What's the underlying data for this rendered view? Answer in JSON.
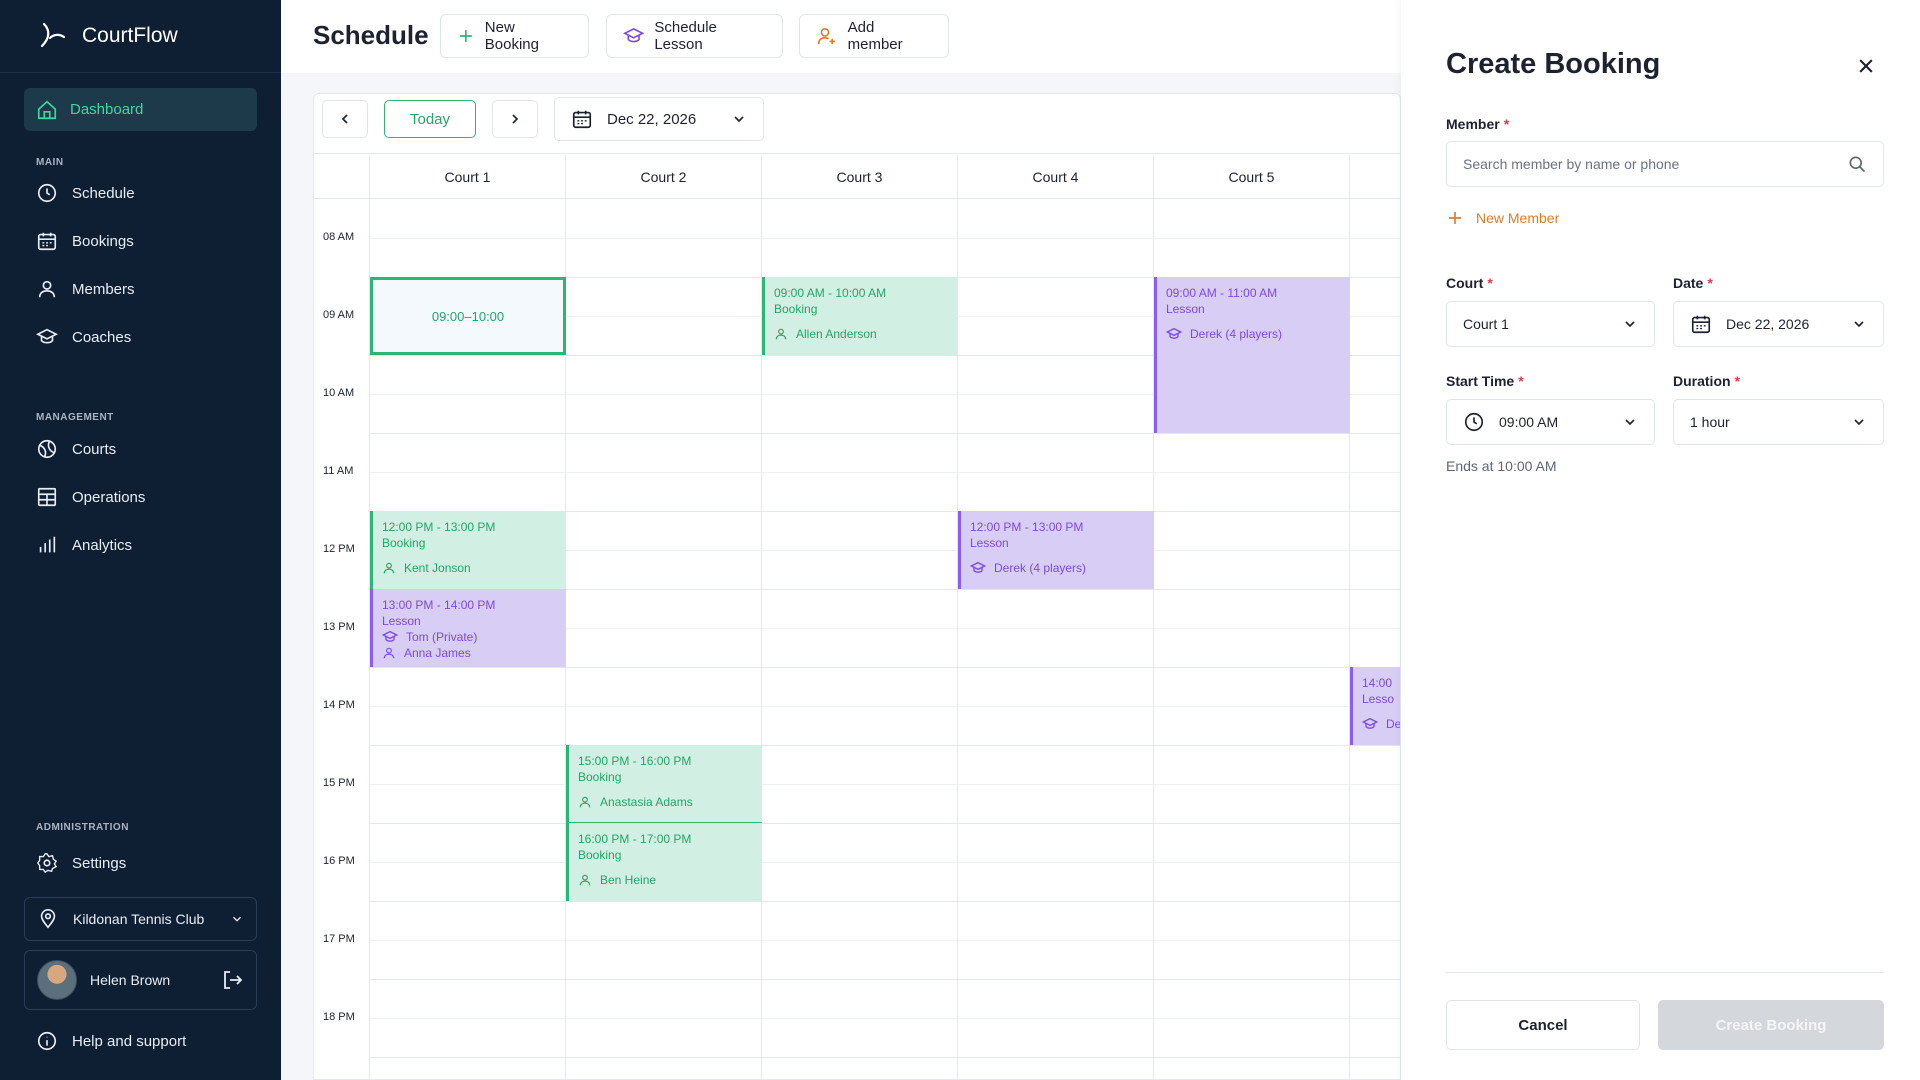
{
  "app": {
    "name": "CourtFlow"
  },
  "sidebar": {
    "dashboard_label": "Dashboard",
    "sections": {
      "main": "MAIN",
      "management": "MANAGEMENT",
      "administration": "ADMINISTRATION"
    },
    "main_items": [
      "Schedule",
      "Bookings",
      "Members",
      "Coaches"
    ],
    "management_items": [
      "Courts",
      "Operations",
      "Analytics"
    ],
    "settings_label": "Settings",
    "club_name": "Kildonan Tennis Club",
    "user_name": "Helen Brown",
    "help_label": "Help and support"
  },
  "header": {
    "title": "Schedule",
    "new_booking": "New Booking",
    "schedule_lesson": "Schedule Lesson",
    "add_member": "Add member"
  },
  "calendar": {
    "today_label": "Today",
    "date": "Dec 22, 2026",
    "courts": [
      "Court 1",
      "Court 2",
      "Court 3",
      "Court 4",
      "Court 5"
    ],
    "hours": [
      "08 AM",
      "09 AM",
      "10 AM",
      "11 AM",
      "12 PM",
      "13 PM",
      "14 PM",
      "15 PM",
      "16 PM",
      "17 PM",
      "18 PM"
    ],
    "selected_slot": "09:00–10:00",
    "events": {
      "c3_0900": {
        "time": "09:00 AM - 10:00 AM",
        "type": "Booking",
        "person": "Allen Anderson"
      },
      "c5_0900": {
        "time": "09:00 AM - 11:00 AM",
        "type": "Lesson",
        "person": "Derek (4 players)"
      },
      "c1_1200": {
        "time": "12:00 PM - 13:00 PM",
        "type": "Booking",
        "person": "Kent Jonson"
      },
      "c4_1200": {
        "time": "12:00 PM - 13:00 PM",
        "type": "Lesson",
        "person": "Derek (4 players)"
      },
      "c1_1300": {
        "time": "13:00 PM - 14:00 PM",
        "type": "Lesson",
        "coach": "Tom (Private)",
        "person": "Anna James"
      },
      "c6_1400": {
        "time": "14:00",
        "type": "Lesso",
        "person": "De"
      },
      "c2_1500": {
        "time": "15:00 PM - 16:00 PM",
        "type": "Booking",
        "person": "Anastasia Adams"
      },
      "c2_1600": {
        "time": "16:00 PM - 17:00 PM",
        "type": "Booking",
        "person": "Ben Heine"
      }
    }
  },
  "panel": {
    "title": "Create Booking",
    "member_label": "Member",
    "member_placeholder": "Search member by name or phone",
    "new_member_label": "New Member",
    "court_label": "Court",
    "court_value": "Court 1",
    "date_label": "Date",
    "date_value": "Dec 22, 2026",
    "start_time_label": "Start Time",
    "start_time_value": "09:00 AM",
    "duration_label": "Duration",
    "duration_value": "1 hour",
    "ends_text": "Ends at 10:00 AM",
    "required_mark": "*",
    "cancel_label": "Cancel",
    "create_label": "Create Booking"
  },
  "colors": {
    "sidebar_bg": "#0f1f33",
    "accent_green": "#2bb673",
    "lesson_purple": "#8b5cf6",
    "orange": "#e07a29",
    "required_red": "#e0384a"
  }
}
